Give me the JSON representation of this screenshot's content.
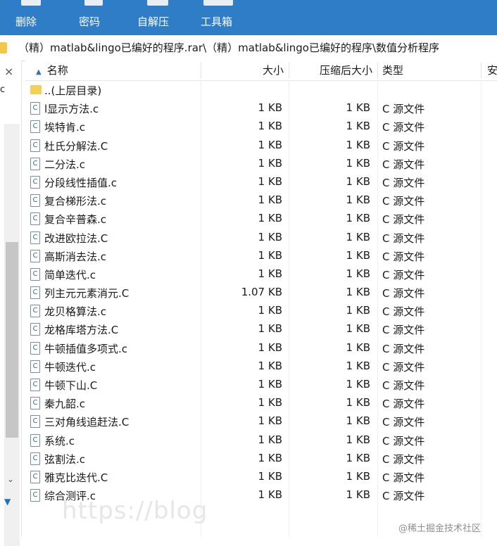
{
  "toolbar": {
    "buttons": [
      {
        "label": "删除"
      },
      {
        "label": "密码"
      },
      {
        "label": "自解压"
      },
      {
        "label": "工具箱"
      }
    ]
  },
  "address": {
    "path": "（精）matlab&lingo已编好的程序.rar\\（精）matlab&lingo已编好的程序\\数值分析程序"
  },
  "left_pane": {
    "close_glyph": "×",
    "cut_text": "c"
  },
  "columns": {
    "name": "名称",
    "size": "大小",
    "compressed": "压缩后大小",
    "type": "类型",
    "extra": "安"
  },
  "files": [
    {
      "name": "..(上层目录)",
      "size": "",
      "compressed": "",
      "type": "",
      "icon": "folder-icon"
    },
    {
      "name": "l显示方法.c",
      "size": "1 KB",
      "compressed": "1 KB",
      "type": "C 源文件",
      "icon": "c-file-icon"
    },
    {
      "name": "埃特肯.c",
      "size": "1 KB",
      "compressed": "1 KB",
      "type": "C 源文件",
      "icon": "c-file-icon"
    },
    {
      "name": "杜氏分解法.C",
      "size": "1 KB",
      "compressed": "1 KB",
      "type": "C 源文件",
      "icon": "c-file-icon"
    },
    {
      "name": "二分法.c",
      "size": "1 KB",
      "compressed": "1 KB",
      "type": "C 源文件",
      "icon": "c-file-icon"
    },
    {
      "name": "分段线性插值.c",
      "size": "1 KB",
      "compressed": "1 KB",
      "type": "C 源文件",
      "icon": "c-file-icon"
    },
    {
      "name": "复合梯形法.c",
      "size": "1 KB",
      "compressed": "1 KB",
      "type": "C 源文件",
      "icon": "c-file-icon"
    },
    {
      "name": "复合辛普森.c",
      "size": "1 KB",
      "compressed": "1 KB",
      "type": "C 源文件",
      "icon": "c-file-icon"
    },
    {
      "name": "改进欧拉法.C",
      "size": "1 KB",
      "compressed": "1 KB",
      "type": "C 源文件",
      "icon": "c-file-icon"
    },
    {
      "name": "高斯消去法.c",
      "size": "1 KB",
      "compressed": "1 KB",
      "type": "C 源文件",
      "icon": "c-file-icon"
    },
    {
      "name": "简单迭代.c",
      "size": "1 KB",
      "compressed": "1 KB",
      "type": "C 源文件",
      "icon": "c-file-icon"
    },
    {
      "name": "列主元元素消元.C",
      "size": "1.07 KB",
      "compressed": "1 KB",
      "type": "C 源文件",
      "icon": "c-file-icon"
    },
    {
      "name": "龙贝格算法.c",
      "size": "1 KB",
      "compressed": "1 KB",
      "type": "C 源文件",
      "icon": "c-file-icon"
    },
    {
      "name": "龙格库塔方法.C",
      "size": "1 KB",
      "compressed": "1 KB",
      "type": "C 源文件",
      "icon": "c-file-icon"
    },
    {
      "name": "牛顿插值多项式.c",
      "size": "1 KB",
      "compressed": "1 KB",
      "type": "C 源文件",
      "icon": "c-file-icon"
    },
    {
      "name": "牛顿迭代.c",
      "size": "1 KB",
      "compressed": "1 KB",
      "type": "C 源文件",
      "icon": "c-file-icon"
    },
    {
      "name": "牛顿下山.C",
      "size": "1 KB",
      "compressed": "1 KB",
      "type": "C 源文件",
      "icon": "c-file-icon"
    },
    {
      "name": "秦九韶.c",
      "size": "1 KB",
      "compressed": "1 KB",
      "type": "C 源文件",
      "icon": "c-file-icon"
    },
    {
      "name": "三对角线追赶法.C",
      "size": "1 KB",
      "compressed": "1 KB",
      "type": "C 源文件",
      "icon": "c-file-icon"
    },
    {
      "name": "系统.c",
      "size": "1 KB",
      "compressed": "1 KB",
      "type": "C 源文件",
      "icon": "c-file-icon"
    },
    {
      "name": "弦割法.c",
      "size": "1 KB",
      "compressed": "1 KB",
      "type": "C 源文件",
      "icon": "c-file-icon"
    },
    {
      "name": "雅克比迭代.C",
      "size": "1 KB",
      "compressed": "1 KB",
      "type": "C 源文件",
      "icon": "c-file-icon"
    },
    {
      "name": "综合测评.c",
      "size": "1 KB",
      "compressed": "1 KB",
      "type": "C 源文件",
      "icon": "c-file-icon"
    }
  ],
  "watermark": {
    "left_text": "https://blog",
    "right_text": "@稀土掘金技术社区"
  },
  "colors": {
    "toolbar_bg": "#2f7dc7",
    "folder": "#f6cf58"
  }
}
